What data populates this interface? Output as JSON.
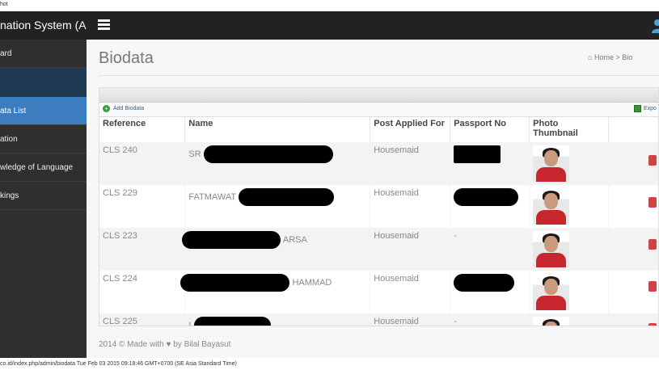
{
  "page": {
    "header_text": "hot",
    "footer_text": "co.id/index.php/admin/biodata Tue Feb 03 2015 09:18:46 GMT+0700 (SE Asia Standard Time)"
  },
  "topbar": {
    "brand": "nation System (AIS)"
  },
  "sidebar": {
    "items": [
      {
        "label": "ard"
      },
      {
        "label": ""
      },
      {
        "label": "ata List"
      },
      {
        "label": "ation"
      },
      {
        "label": "wledge of Language"
      },
      {
        "label": "kings"
      }
    ]
  },
  "main": {
    "title": "Biodata",
    "breadcrumb": {
      "home": "Home",
      "separator": ">",
      "current": "Bio"
    },
    "toolbar": {
      "add_label": "Add Biodata",
      "add_icon": "+",
      "export_label": "Expo"
    },
    "table": {
      "columns": [
        "Reference",
        "Name",
        "Post Applied For",
        "Passport No",
        "Photo Thumbnail",
        ""
      ],
      "rows": [
        {
          "reference": "CLS 240",
          "name": "SR",
          "post": "Housemaid",
          "passport": "",
          "style": "odd"
        },
        {
          "reference": "CLS 229",
          "name": "FATMAWAT",
          "post": "Housemaid",
          "passport": "",
          "style": "even"
        },
        {
          "reference": "CLS 223",
          "name": "ARSA",
          "post": "Housemaid",
          "passport": "-",
          "style": "odd"
        },
        {
          "reference": "CLS 224",
          "name": "HAMMAD",
          "post": "Housemaid",
          "passport": "",
          "style": "even"
        },
        {
          "reference": "CLS 225",
          "name": "I",
          "post": "Housemaid",
          "passport": "-",
          "style": "odd"
        }
      ]
    },
    "copyright": {
      "prefix": "2014 © Made with",
      "suffix": "by Bilal Bayasut",
      "heart": "♥"
    }
  },
  "colors": {
    "topbar": "#222222",
    "sidebar": "#2f2f2f",
    "sidebar_active": "#3b7dbf",
    "action_button": "#cc4444"
  }
}
